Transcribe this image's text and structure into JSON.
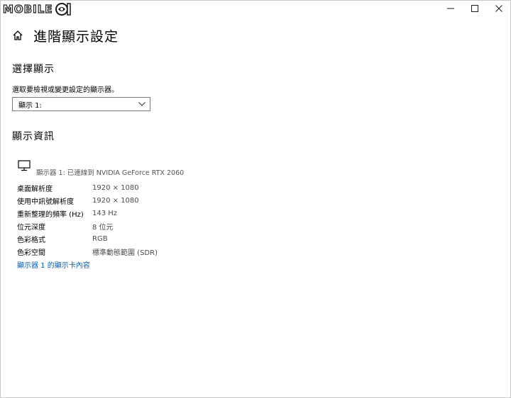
{
  "logo": {
    "text": "MOBILE"
  },
  "window": {
    "minimize_icon": "minimize-icon",
    "maximize_icon": "maximize-icon",
    "close_icon": "close-icon"
  },
  "header": {
    "title": "進階顯示設定",
    "home_icon": "home-icon"
  },
  "select_display": {
    "heading": "選擇顯示",
    "prompt": "選取要檢視或變更設定的顯示器。",
    "selected": "顯示 1:"
  },
  "display_info": {
    "heading": "顯示資訊",
    "monitor_caption": "顯示器 1: 已連線到 NVIDIA GeForce RTX 2060",
    "rows": [
      {
        "key": "桌面解析度",
        "value": "1920 × 1080"
      },
      {
        "key": "使用中訊號解析度",
        "value": "1920 × 1080"
      },
      {
        "key": "重新整理的頻率 (Hz)",
        "value": "143 Hz"
      },
      {
        "key": "位元深度",
        "value": "8 位元"
      },
      {
        "key": "色彩格式",
        "value": "RGB"
      },
      {
        "key": "色彩空間",
        "value": "標準動態範圍 (SDR)"
      }
    ],
    "adapter_link": "顯示器 1 的顯示卡內容"
  }
}
